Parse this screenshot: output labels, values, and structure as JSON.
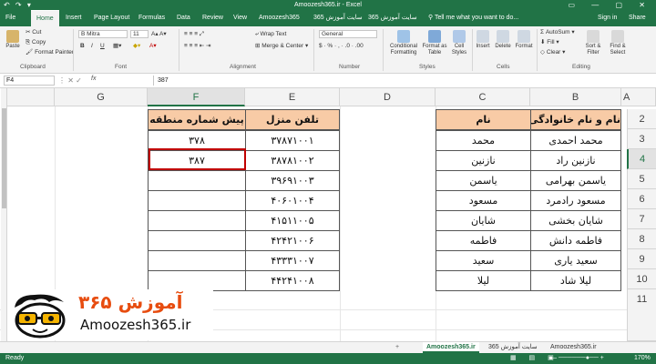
{
  "window": {
    "title": "Amoozesh365.ir - Excel",
    "quick_access": "↶ ↷ ▾",
    "controls": "▭ — ▢ ✕"
  },
  "ribbon_tabs": [
    "File",
    "Home",
    "Insert",
    "Page Layout",
    "Formulas",
    "Data",
    "Review",
    "View",
    "Amoozesh365",
    "سایت آموزش 365",
    "سایت آموزش 365"
  ],
  "tell_me": "Tell me what you want to do...",
  "sign_in": "Sign in",
  "share": "Share",
  "clipboard": {
    "paste": "Paste",
    "cut": "Cut",
    "copy": "Copy",
    "format_painter": "Format Painter",
    "label": "Clipboard"
  },
  "font": {
    "name": "B Mitra",
    "size": "11",
    "label": "Font",
    "bold": "B",
    "italic": "I",
    "underline": "U"
  },
  "alignment": {
    "wrap": "Wrap Text",
    "merge": "Merge & Center",
    "label": "Alignment"
  },
  "number": {
    "format": "General",
    "label": "Number",
    "tools": "$ · % · , · .0 · .00"
  },
  "styles": {
    "conditional": "Conditional Formatting",
    "format_table": "Format as Table",
    "cell_styles": "Cell Styles",
    "label": "Styles"
  },
  "cells": {
    "insert": "Insert",
    "delete": "Delete",
    "format": "Format",
    "label": "Cells"
  },
  "editing": {
    "autosum": "AutoSum",
    "fill": "Fill",
    "clear": "Clear",
    "sort": "Sort & Filter",
    "find": "Find & Select",
    "label": "Editing"
  },
  "formula_bar": {
    "name_box": "F4",
    "fx": "fx",
    "value": "387"
  },
  "columns": [
    "G",
    "F",
    "E",
    "D",
    "C",
    "B",
    "A"
  ],
  "rows": [
    "2",
    "3",
    "4",
    "5",
    "6",
    "7",
    "8",
    "9",
    "10",
    "11"
  ],
  "table_right": {
    "headers": [
      "نام",
      "نام و نام خانوادگی"
    ],
    "rows": [
      [
        "محمد",
        "محمد احمدی"
      ],
      [
        "نازنین",
        "نازنین راد"
      ],
      [
        "یاسمن",
        "یاسمن بهرامی"
      ],
      [
        "مسعود",
        "مسعود رادمرد"
      ],
      [
        "شایان",
        "شایان بخشی"
      ],
      [
        "فاطمه",
        "فاطمه دانش"
      ],
      [
        "سعید",
        "سعید یاری"
      ],
      [
        "لیلا",
        "لیلا شاد"
      ]
    ]
  },
  "table_left": {
    "headers": [
      "پیش شماره منطقه",
      "تلفن منزل"
    ],
    "rows": [
      [
        "۳۷۸",
        "۳۷۸۷۱۰۰۱"
      ],
      [
        "۳۸۷",
        "۳۸۷۸۱۰۰۲"
      ],
      [
        "",
        "۳۹۶۹۱۰۰۳"
      ],
      [
        "",
        "۴۰۶۰۱۰۰۴"
      ],
      [
        "",
        "۴۱۵۱۱۰۰۵"
      ],
      [
        "",
        "۴۲۴۲۱۰۰۶"
      ],
      [
        "",
        "۴۳۳۳۱۰۰۷"
      ],
      [
        "",
        "۴۴۲۴۱۰۰۸"
      ]
    ]
  },
  "sheets": {
    "tabs": [
      "Amoozesh365.ir",
      "سایت آموزش 365",
      "Amoozesh365.ir"
    ],
    "active_index": 0,
    "add": "+"
  },
  "status": {
    "left": "Ready",
    "zoom": "170%"
  },
  "logo": {
    "fa": "آموزش ۳۶۵",
    "en": "Amoozesh365.ir"
  },
  "colors": {
    "excel_green": "#217346",
    "header_fill": "#f8cba6",
    "selection": "#c00000",
    "logo_orange": "#e74c0f"
  }
}
